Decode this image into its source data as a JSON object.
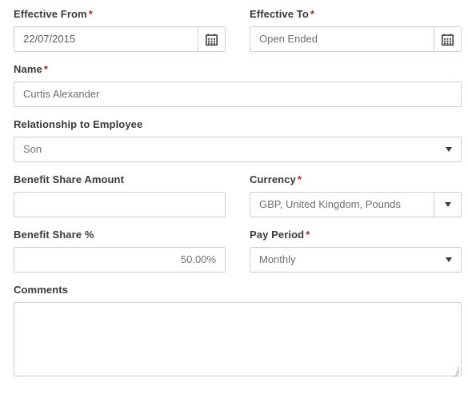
{
  "form": {
    "fields": {
      "effective_from": {
        "label": "Effective From",
        "required": "*",
        "value": "22/07/2015",
        "icon": "calendar-icon"
      },
      "effective_to": {
        "label": "Effective To",
        "required": "*",
        "value": "Open Ended",
        "icon": "calendar-icon"
      },
      "name": {
        "label": "Name",
        "required": "*",
        "value": "Curtis Alexander"
      },
      "relationship": {
        "label": "Relationship to Employee",
        "required": "",
        "value": "Son",
        "icon": "chevron-down-icon"
      },
      "benefit_share_amount": {
        "label": "Benefit Share Amount",
        "required": "",
        "value": ""
      },
      "currency": {
        "label": "Currency",
        "required": "*",
        "value": "GBP, United Kingdom, Pounds",
        "icon": "chevron-down-icon"
      },
      "benefit_share_percent": {
        "label": "Benefit Share %",
        "required": "",
        "value": "50.00%"
      },
      "pay_period": {
        "label": "Pay Period",
        "required": "*",
        "value": "Monthly",
        "icon": "chevron-down-icon"
      },
      "comments": {
        "label": "Comments",
        "required": "",
        "value": ""
      }
    },
    "colors": {
      "required_asterisk": "#9e2a2b",
      "label_text": "#3a3a3a",
      "field_border": "#cfcfcf",
      "field_text": "#6f6f6f",
      "background": "#ffffff"
    }
  }
}
